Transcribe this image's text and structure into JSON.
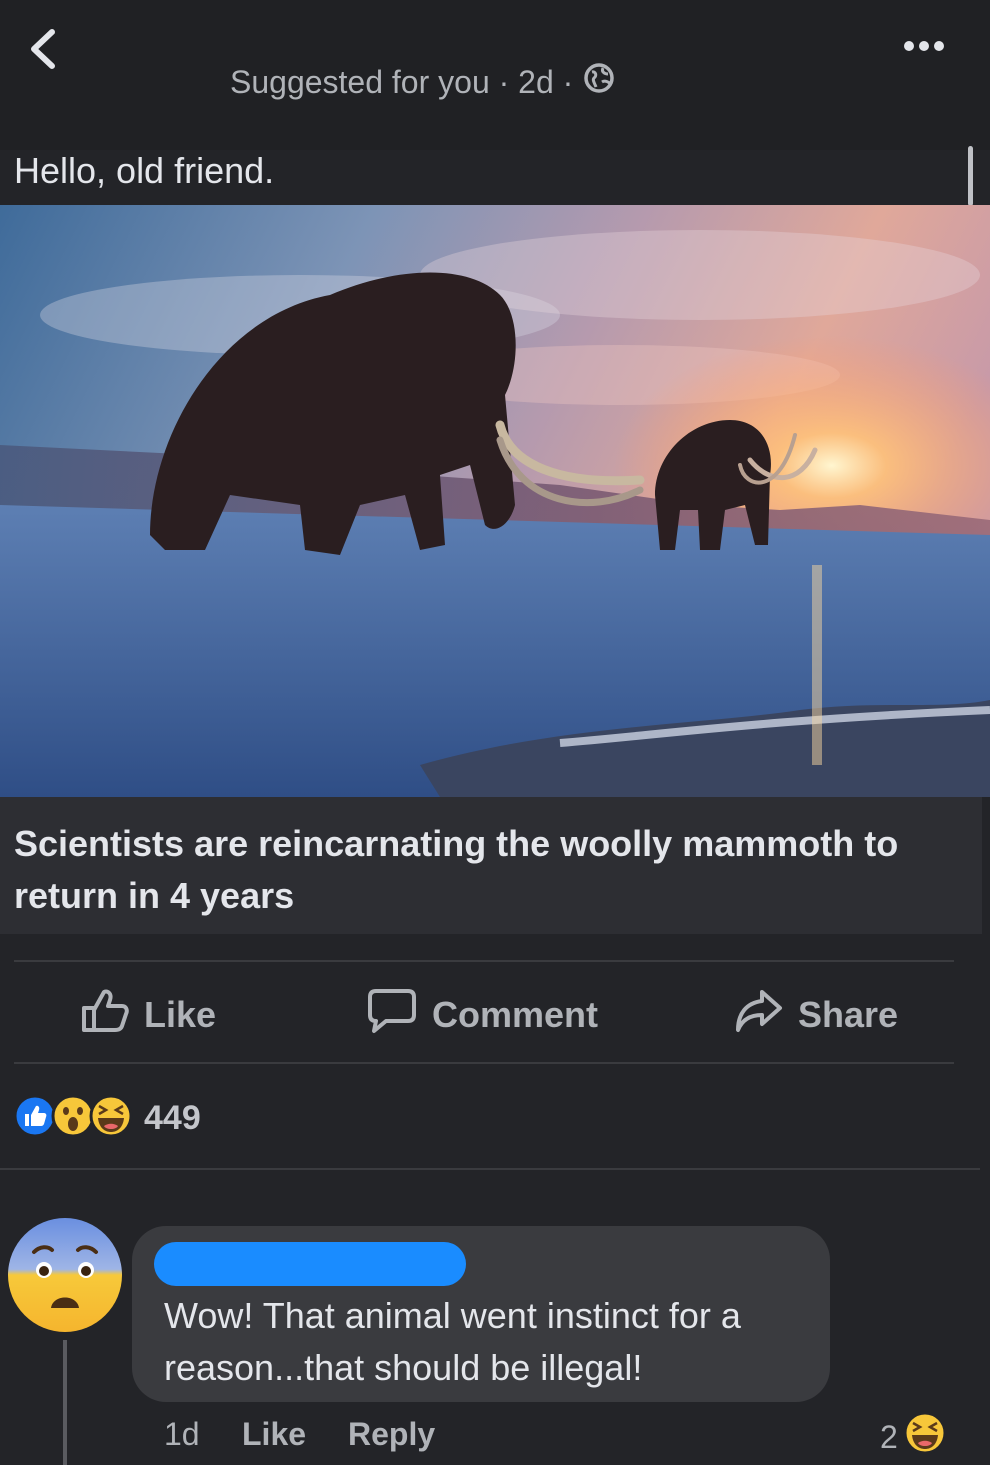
{
  "header": {
    "meta_text": "Suggested for you · 2d ·"
  },
  "post": {
    "caption": "Hello, old friend.",
    "link_title": "Scientists are reincarnating the woolly mammoth to return in 4 years"
  },
  "actions": {
    "like": "Like",
    "comment": "Comment",
    "share": "Share"
  },
  "reactions": {
    "count": "449",
    "icons": [
      "like-reaction-icon",
      "wow-reaction-icon",
      "haha-reaction-icon"
    ]
  },
  "comment": {
    "text": "Wow! That animal went instinct for a reason...that should be illegal!",
    "time": "1d",
    "like": "Like",
    "reply": "Reply",
    "reaction_count": "2",
    "reaction_icon": "haha-reaction-icon",
    "avatar_icon": "fearful-face-emoji"
  },
  "colors": {
    "background": "#232428",
    "text": "#e4e6eb",
    "muted": "#b0b3b8",
    "accent_blue": "#1a8cff",
    "link_box": "#2d2e33"
  }
}
